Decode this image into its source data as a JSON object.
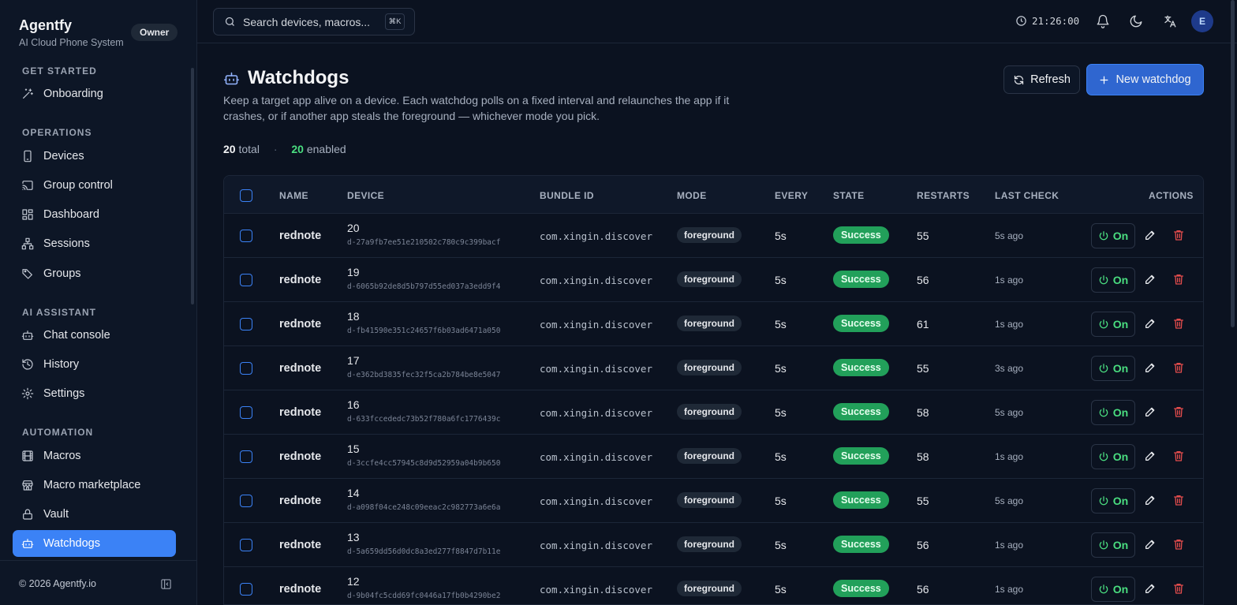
{
  "app": {
    "name": "Agentfy",
    "subtitle": "AI Cloud Phone System",
    "role_badge": "Owner"
  },
  "sidebar": {
    "sections": [
      {
        "title": "GET STARTED"
      },
      {
        "title": "OPERATIONS"
      },
      {
        "title": "AI ASSISTANT"
      },
      {
        "title": "AUTOMATION"
      }
    ],
    "items": [
      {
        "label": "Onboarding",
        "icon": "wand-icon"
      },
      {
        "label": "Devices",
        "icon": "phone-icon"
      },
      {
        "label": "Group control",
        "icon": "cast-icon"
      },
      {
        "label": "Dashboard",
        "icon": "dashboard-icon"
      },
      {
        "label": "Sessions",
        "icon": "network-icon"
      },
      {
        "label": "Groups",
        "icon": "tags-icon"
      },
      {
        "label": "Chat console",
        "icon": "bot-icon"
      },
      {
        "label": "History",
        "icon": "history-icon"
      },
      {
        "label": "Settings",
        "icon": "gear-icon"
      },
      {
        "label": "Macros",
        "icon": "film-icon"
      },
      {
        "label": "Macro marketplace",
        "icon": "store-icon"
      },
      {
        "label": "Vault",
        "icon": "lock-icon"
      },
      {
        "label": "Watchdogs",
        "icon": "bot-icon",
        "active": true
      }
    ],
    "footer": {
      "copyright": "© 2026 Agentfy.io"
    }
  },
  "topbar": {
    "search_placeholder": "Search devices, macros...",
    "shortcut": "⌘K",
    "time": "21:26:00",
    "avatar_initial": "E"
  },
  "page": {
    "title": "Watchdogs",
    "description": "Keep a target app alive on a device. Each watchdog polls on a fixed interval and relaunches the app if it crashes, or if another app steals the foreground — whichever mode you pick.",
    "stats": {
      "total": "20",
      "total_label": "total",
      "enabled": "20",
      "enabled_label": "enabled"
    },
    "refresh_label": "Refresh",
    "new_label": "New watchdog"
  },
  "table": {
    "columns": [
      "NAME",
      "DEVICE",
      "BUNDLE ID",
      "MODE",
      "EVERY",
      "STATE",
      "RESTARTS",
      "LAST CHECK",
      "ACTIONS"
    ],
    "rows": [
      {
        "name": "rednote",
        "device": "20",
        "device_id": "d-27a9fb7ee51e210502c780c9c399bacf",
        "bundle": "com.xingin.discover",
        "mode": "foreground",
        "every": "5s",
        "state": "Success",
        "restarts": "55",
        "last_check": "5s ago",
        "toggle": "On"
      },
      {
        "name": "rednote",
        "device": "19",
        "device_id": "d-6065b92de8d5b797d55ed037a3edd9f4",
        "bundle": "com.xingin.discover",
        "mode": "foreground",
        "every": "5s",
        "state": "Success",
        "restarts": "56",
        "last_check": "1s ago",
        "toggle": "On"
      },
      {
        "name": "rednote",
        "device": "18",
        "device_id": "d-fb41590e351c24657f6b03ad6471a050",
        "bundle": "com.xingin.discover",
        "mode": "foreground",
        "every": "5s",
        "state": "Success",
        "restarts": "61",
        "last_check": "1s ago",
        "toggle": "On"
      },
      {
        "name": "rednote",
        "device": "17",
        "device_id": "d-e362bd3835fec32f5ca2b784be8e5047",
        "bundle": "com.xingin.discover",
        "mode": "foreground",
        "every": "5s",
        "state": "Success",
        "restarts": "55",
        "last_check": "3s ago",
        "toggle": "On"
      },
      {
        "name": "rednote",
        "device": "16",
        "device_id": "d-633fccededc73b52f780a6fc1776439c",
        "bundle": "com.xingin.discover",
        "mode": "foreground",
        "every": "5s",
        "state": "Success",
        "restarts": "58",
        "last_check": "5s ago",
        "toggle": "On"
      },
      {
        "name": "rednote",
        "device": "15",
        "device_id": "d-3ccfe4cc57945c8d9d52959a04b9b650",
        "bundle": "com.xingin.discover",
        "mode": "foreground",
        "every": "5s",
        "state": "Success",
        "restarts": "58",
        "last_check": "1s ago",
        "toggle": "On"
      },
      {
        "name": "rednote",
        "device": "14",
        "device_id": "d-a098f04ce248c09eeac2c982773a6e6a",
        "bundle": "com.xingin.discover",
        "mode": "foreground",
        "every": "5s",
        "state": "Success",
        "restarts": "55",
        "last_check": "5s ago",
        "toggle": "On"
      },
      {
        "name": "rednote",
        "device": "13",
        "device_id": "d-5a659dd56d0dc8a3ed277f8847d7b11e",
        "bundle": "com.xingin.discover",
        "mode": "foreground",
        "every": "5s",
        "state": "Success",
        "restarts": "56",
        "last_check": "1s ago",
        "toggle": "On"
      },
      {
        "name": "rednote",
        "device": "12",
        "device_id": "d-9b04fc5cdd69fc0446a17fb0b4290be2",
        "bundle": "com.xingin.discover",
        "mode": "foreground",
        "every": "5s",
        "state": "Success",
        "restarts": "56",
        "last_check": "1s ago",
        "toggle": "On"
      }
    ]
  },
  "colors": {
    "accent": "#3b82f6",
    "primary_button": "#2f66d0",
    "success": "#22a05a",
    "toggle_on": "#4ade80",
    "danger": "#e24c4c",
    "background": "#0b1220"
  }
}
